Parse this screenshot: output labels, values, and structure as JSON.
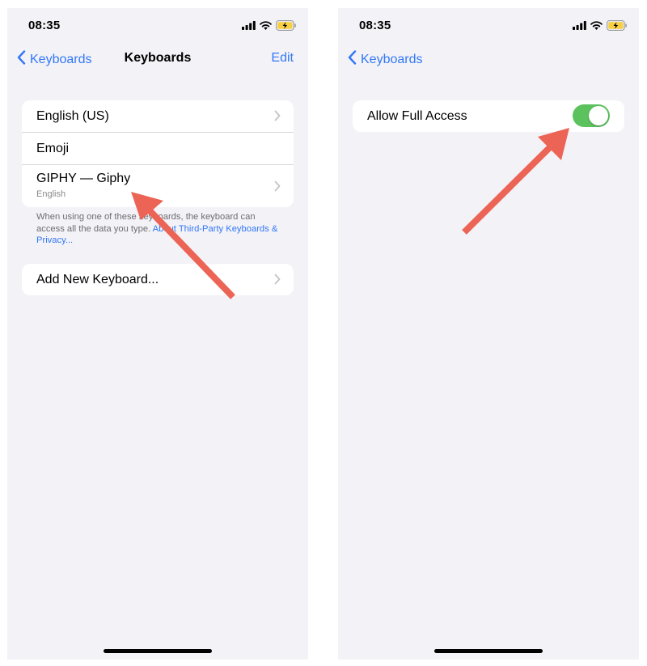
{
  "left_screen": {
    "status": {
      "time": "08:35"
    },
    "nav": {
      "back_label": "Keyboards",
      "title": "Keyboards",
      "edit_label": "Edit"
    },
    "keyboards": [
      {
        "label": "English (US)",
        "sublabel": "",
        "has_chevron": true
      },
      {
        "label": "Emoji",
        "sublabel": "",
        "has_chevron": false
      },
      {
        "label": "GIPHY — Giphy",
        "sublabel": "English",
        "has_chevron": true
      }
    ],
    "footer": {
      "text": "When using one of these keyboards, the keyboard can access all the data you type. ",
      "link": "About Third-Party Keyboards & Privacy..."
    },
    "add_keyboard_label": "Add New Keyboard..."
  },
  "right_screen": {
    "status": {
      "time": "08:35"
    },
    "nav": {
      "back_label": "Keyboards"
    },
    "allow_full_access": {
      "label": "Allow Full Access",
      "enabled": true
    }
  },
  "colors": {
    "accent_blue": "#3478f6",
    "toggle_on": "#5bc25d",
    "battery_charging": "#f7cf43",
    "annotation_arrow": "#ec6455",
    "screen_background": "#f2f2f7"
  },
  "icons": {
    "back": "chevron-left-icon",
    "row_disclosure": "chevron-right-icon",
    "signal": "cellular-signal-icon",
    "wifi": "wifi-icon",
    "battery": "battery-charging-icon",
    "annotation": "red-arrow"
  }
}
